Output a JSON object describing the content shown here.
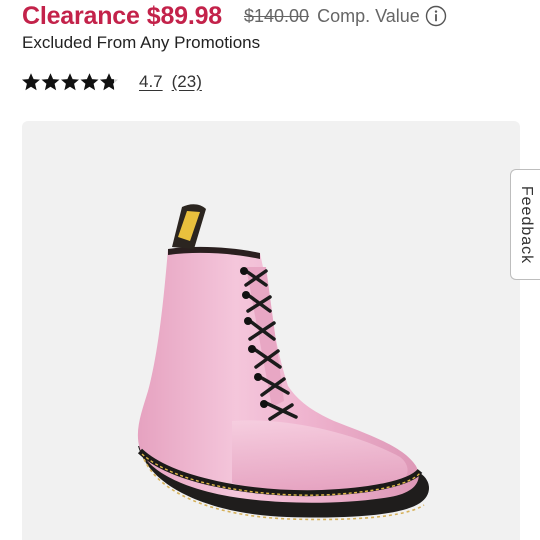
{
  "price": {
    "clearance_label": "Clearance",
    "clearance_price": "$89.98",
    "original_price": "$140.00",
    "comp_value_label": "Comp. Value",
    "info_icon": "info-circle-icon"
  },
  "promo_note": "Excluded From Any Promotions",
  "rating": {
    "stars_out_of_5": 4.7,
    "value": "4.7",
    "count": "(23)",
    "star_icon": "star-icon"
  },
  "product_image": {
    "description_icon": "pink-lace-up-boot-image"
  },
  "feedback": {
    "label": "Feedback"
  },
  "colors": {
    "clearance_red": "#c3224a",
    "muted_text": "#666666",
    "image_bg": "#f1f1f1",
    "boot_pink": "#efb6cf"
  }
}
